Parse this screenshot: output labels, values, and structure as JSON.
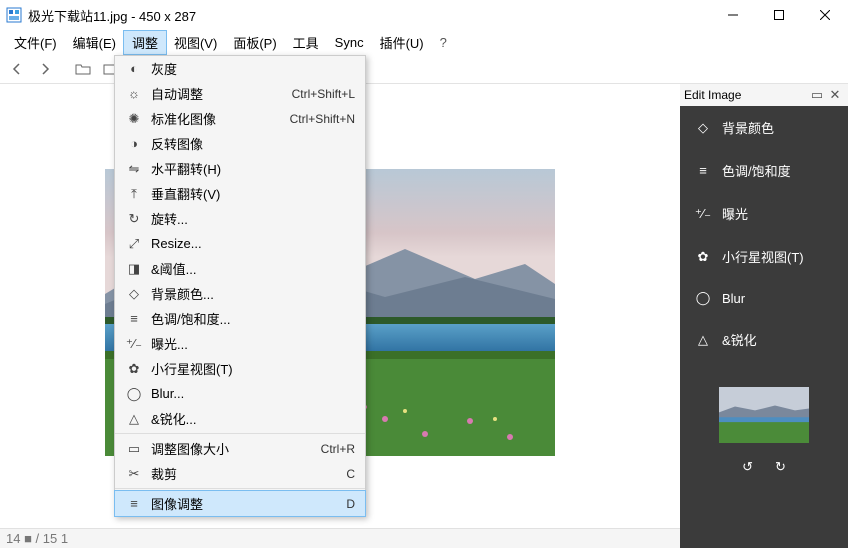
{
  "title": "极光下载站11.jpg  - 450 x 287",
  "menubar": [
    "文件(F)",
    "编辑(E)",
    "调整",
    "视图(V)",
    "面板(P)",
    "工具",
    "Sync",
    "插件(U)",
    "?"
  ],
  "menubar_active_index": 2,
  "dropdown": {
    "items": [
      {
        "icon": "contrast",
        "label": "灰度",
        "accel": ""
      },
      {
        "icon": "sun",
        "label": "自动调整",
        "accel": "Ctrl+Shift+L"
      },
      {
        "icon": "target",
        "label": "标准化图像",
        "accel": "Ctrl+Shift+N"
      },
      {
        "icon": "halfdrop",
        "label": "反转图像",
        "accel": ""
      },
      {
        "icon": "fliph",
        "label": "水平翻转(H)",
        "accel": ""
      },
      {
        "icon": "flipv",
        "label": "垂直翻转(V)",
        "accel": ""
      },
      {
        "icon": "rotate",
        "label": "旋转...",
        "accel": ""
      },
      {
        "icon": "resize",
        "label": "Resize...",
        "accel": ""
      },
      {
        "icon": "threshold",
        "label": "&阈值...",
        "accel": ""
      },
      {
        "icon": "bg",
        "label": "背景颜色...",
        "accel": ""
      },
      {
        "icon": "sliders",
        "label": "色调/饱和度...",
        "accel": ""
      },
      {
        "icon": "exposure",
        "label": "曝光...",
        "accel": ""
      },
      {
        "icon": "planet",
        "label": "小行星视图(T)",
        "accel": ""
      },
      {
        "icon": "drop",
        "label": "Blur...",
        "accel": ""
      },
      {
        "icon": "sharpen",
        "label": "&锐化...",
        "accel": ""
      }
    ],
    "items2": [
      {
        "icon": "canvas",
        "label": "调整图像大小",
        "accel": "Ctrl+R"
      },
      {
        "icon": "crop",
        "label": "裁剪",
        "accel": "C"
      }
    ],
    "items3": [
      {
        "icon": "sliders",
        "label": "图像调整",
        "accel": "D",
        "active": true
      }
    ]
  },
  "sidepanel": {
    "title": "Edit Image",
    "options": [
      {
        "icon": "bg",
        "label": "背景颜色"
      },
      {
        "icon": "sliders",
        "label": "色调/饱和度"
      },
      {
        "icon": "exposure",
        "label": "曝光"
      },
      {
        "icon": "planet",
        "label": "小行星视图(T)"
      },
      {
        "icon": "drop",
        "label": "Blur"
      },
      {
        "icon": "sharpen",
        "label": "&锐化"
      }
    ]
  },
  "statusbar": "14 ■  / 15    1"
}
